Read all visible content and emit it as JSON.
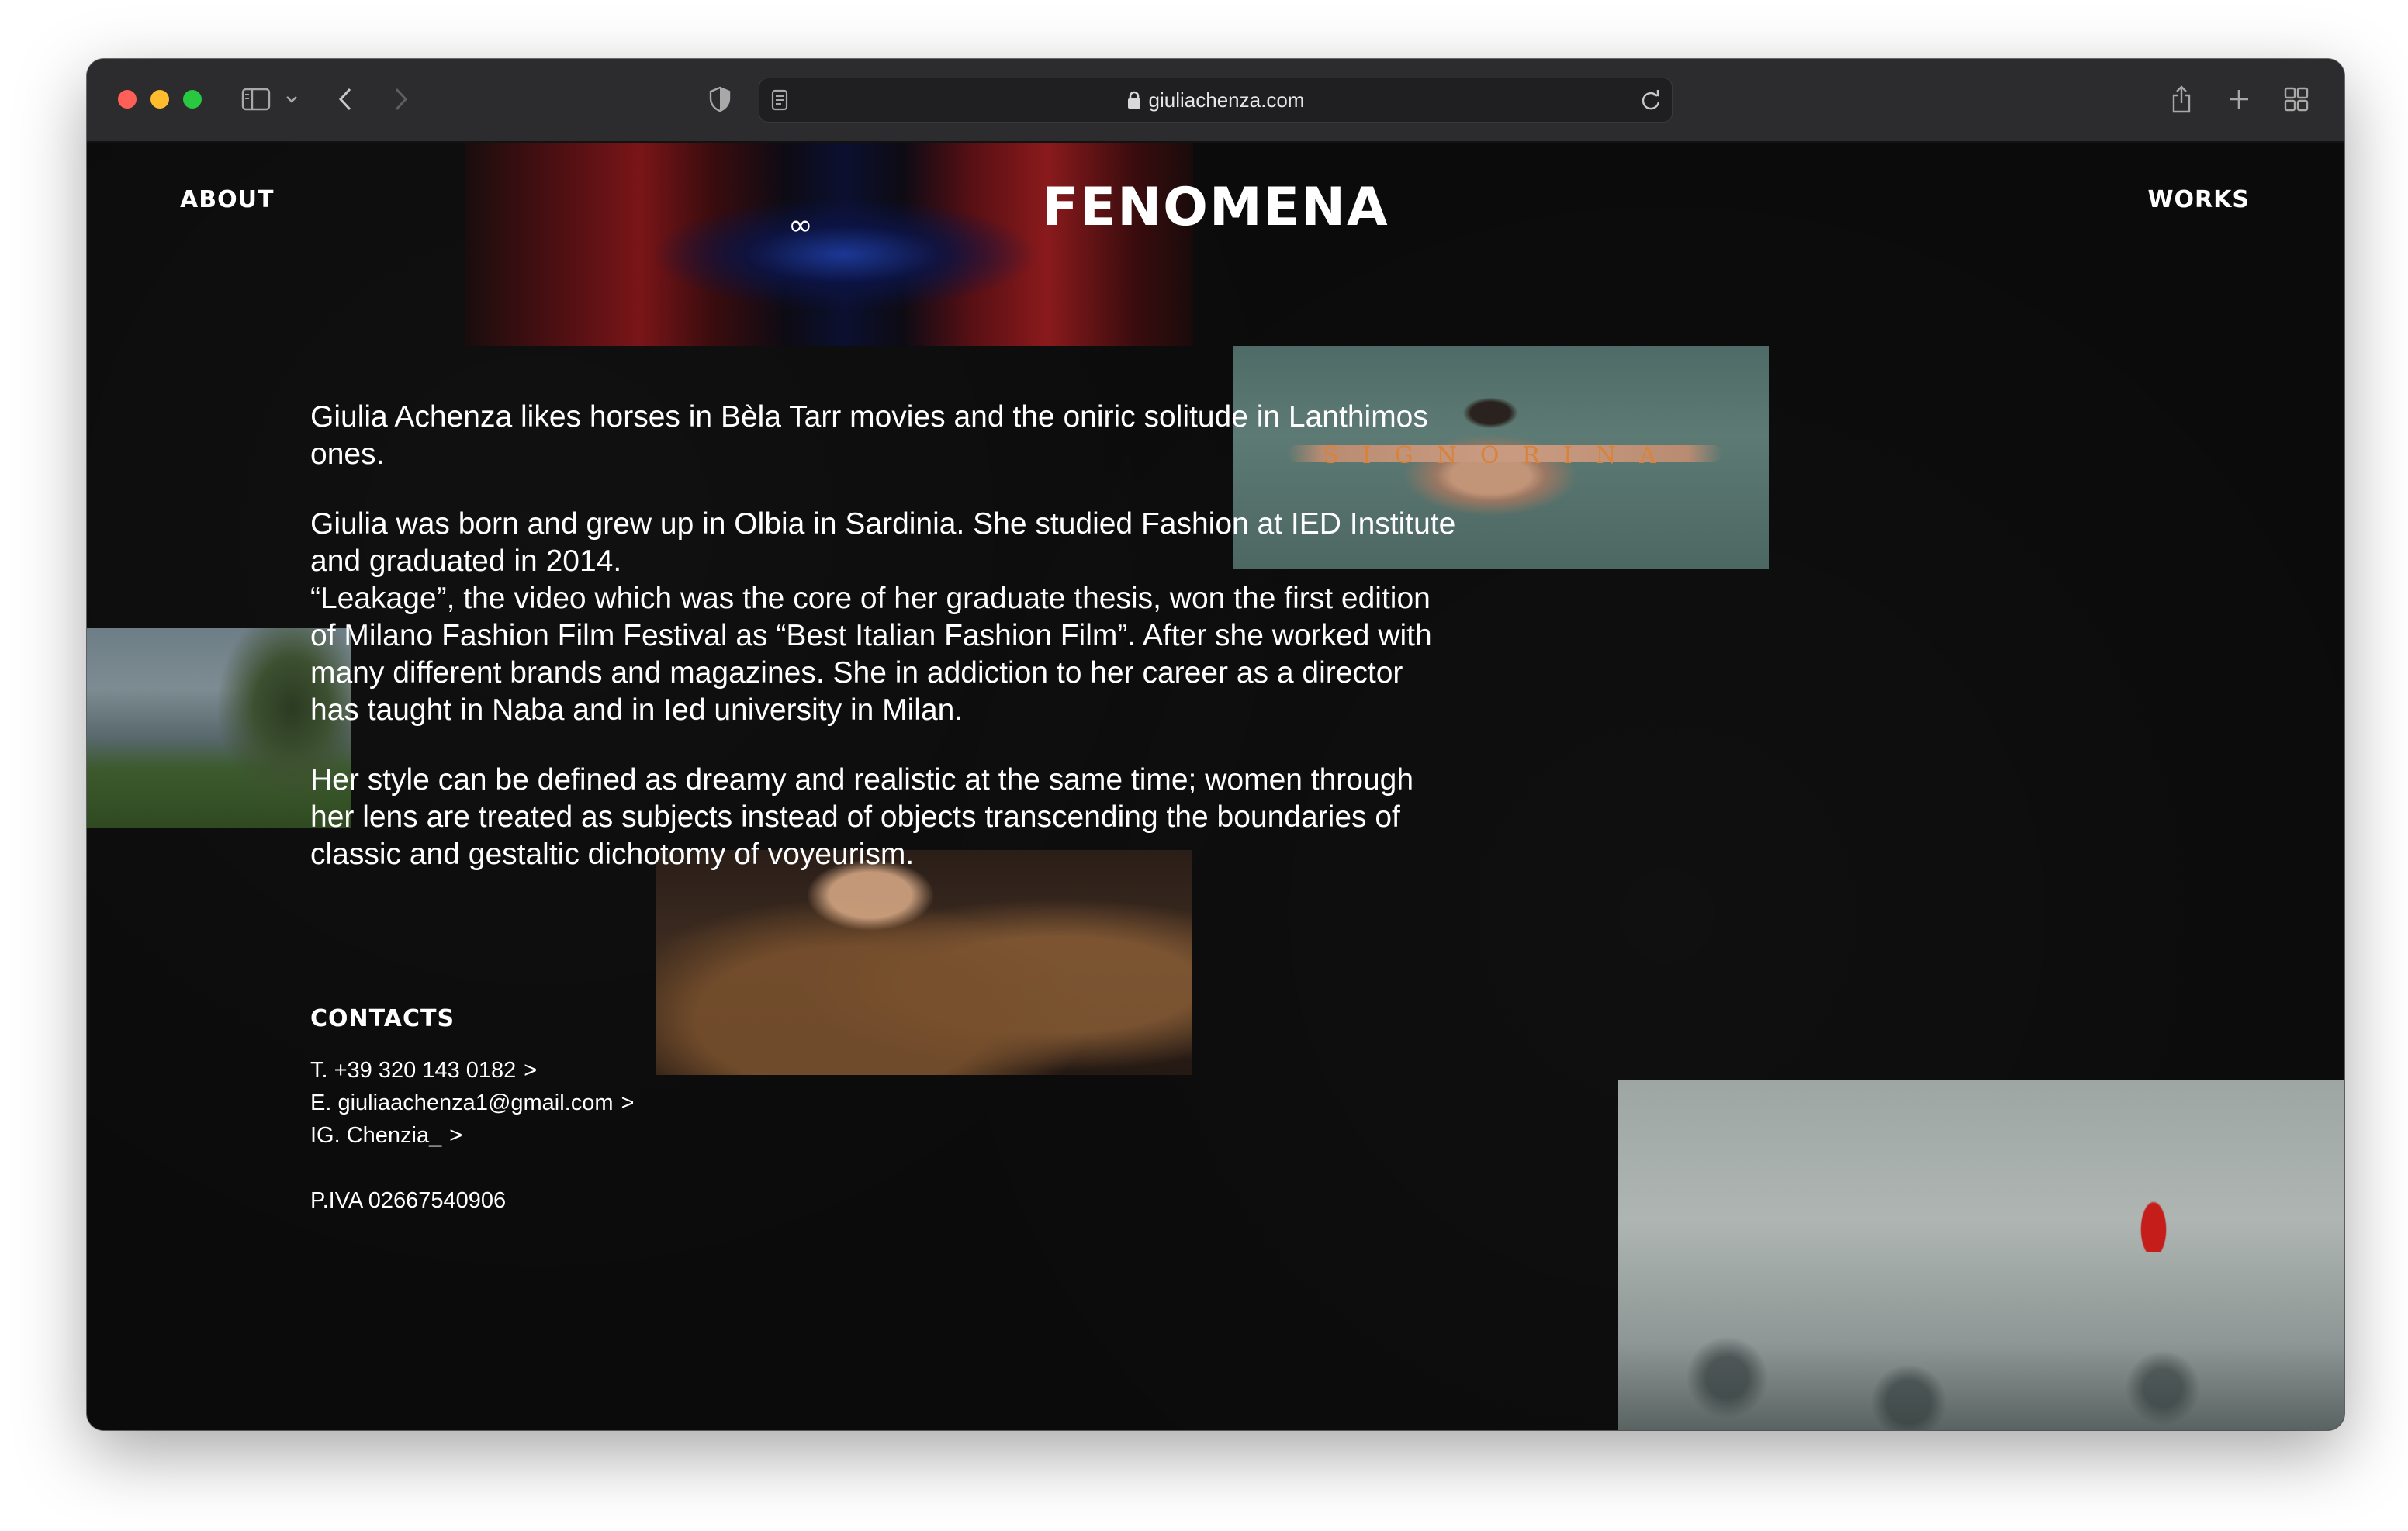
{
  "browser": {
    "url": "giuliachenza.com"
  },
  "nav": {
    "about": "ABOUT",
    "logo": "FENOMENA",
    "works": "WORKS",
    "infinity": "∞"
  },
  "photos": {
    "torso_overlay_text": "SIGNORINA"
  },
  "bio": {
    "p1": "Giulia Achenza likes horses in Bèla Tarr movies and the oniric solitude in Lanthimos ones.",
    "p2a": "Giulia was born and grew up in Olbia in Sardinia. She studied Fashion at IED Institute and graduated in 2014.",
    "p2b": "“Leakage”, the video which was the core of her graduate thesis, won the first edition of Milano Fashion Film Festival as “Best Italian Fashion Film”. After she worked with many different brands and magazines. She in addiction to her career as a director has taught in Naba and in Ied university in Milan.",
    "p3": "Her style can be defined as dreamy and realistic at the same time; women through her lens are treated as subjects instead of objects transcending the boundaries of classic and gestaltic dichotomy of voyeurism."
  },
  "contacts": {
    "title": "CONTACTS",
    "phone": "T. +39 320 143 0182",
    "email": "E. giuliaachenza1@gmail.com",
    "instagram": "IG. Chenzia_",
    "chevron": ">",
    "piva": "P.IVA 02667540906"
  },
  "colors": {
    "background": "#0b0b0b",
    "text": "#ffffff",
    "overlay_word": "#d9823a"
  }
}
